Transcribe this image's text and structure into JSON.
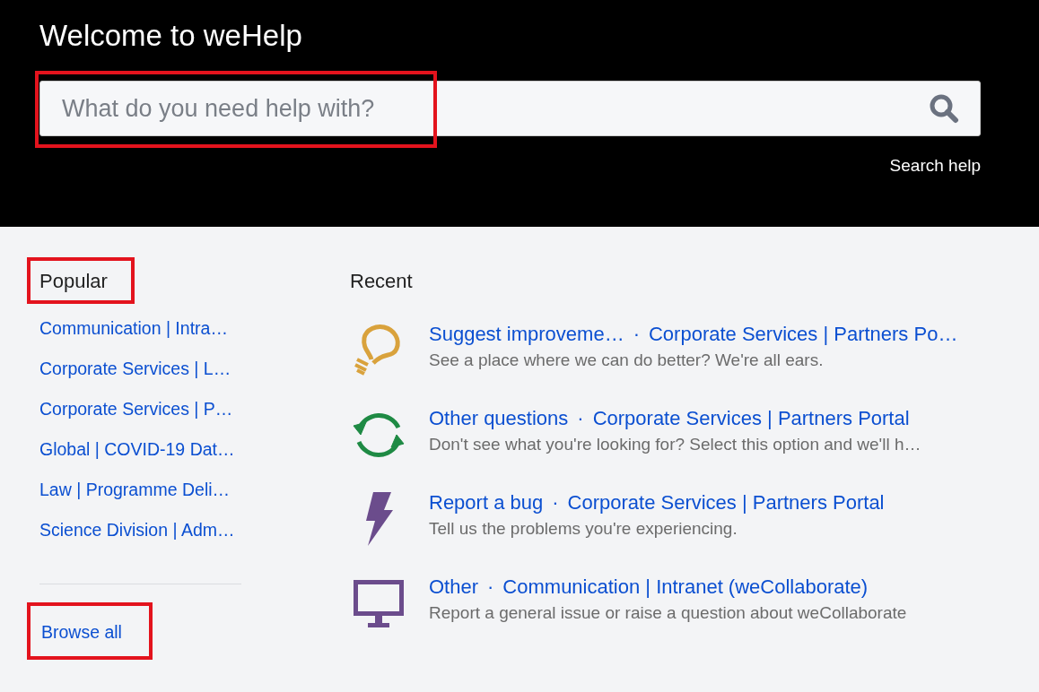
{
  "header": {
    "title": "Welcome to weHelp",
    "search": {
      "placeholder": "What do you need help with?"
    },
    "search_help": "Search help"
  },
  "popular": {
    "heading": "Popular",
    "links": [
      "Communication | Intra…",
      "Corporate Services | L…",
      "Corporate Services | P…",
      "Global | COVID-19 Dat…",
      "Law | Programme Deli…",
      "Science Division | Adm…"
    ],
    "browse_all": "Browse all"
  },
  "recent": {
    "heading": "Recent",
    "items": [
      {
        "kind": "bulb",
        "color": "#d9a23c",
        "title": "Suggest improveme…",
        "separator": "·",
        "portal": "Corporate Services | Partners Po…",
        "description": "See a place where we can do better? We're all ears."
      },
      {
        "kind": "sync",
        "color": "#1e8a44",
        "title": "Other questions",
        "separator": "·",
        "portal": "Corporate Services | Partners Portal",
        "description": "Don't see what you're looking for? Select this option and we'll h…"
      },
      {
        "kind": "bolt",
        "color": "#6b4c8c",
        "title": "Report a bug",
        "separator": "·",
        "portal": "Corporate Services | Partners Portal",
        "description": "Tell us the problems you're experiencing."
      },
      {
        "kind": "monitor",
        "color": "#6b4c8c",
        "title": "Other",
        "separator": "·",
        "portal": "Communication | Intranet (weCollaborate)",
        "description": "Report a general issue or raise a question about weCollaborate"
      }
    ]
  }
}
